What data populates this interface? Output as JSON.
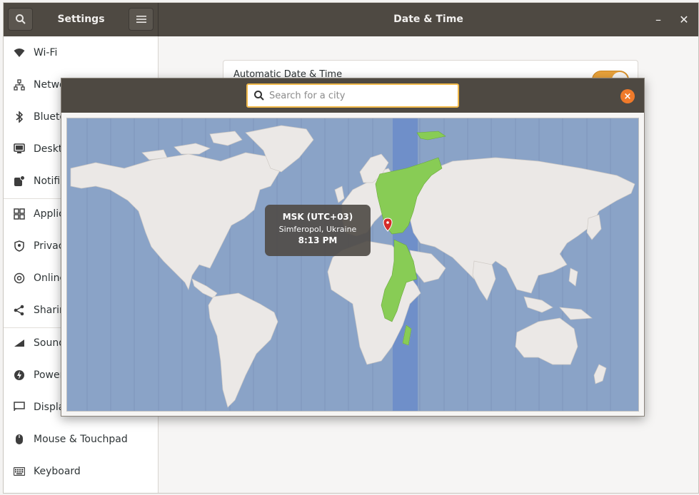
{
  "window": {
    "left_title": "Settings",
    "title": "Date & Time",
    "minimize_label": "–",
    "close_label": "✕"
  },
  "sidebar": {
    "items": [
      {
        "label": "Wi-Fi",
        "icon": "wifi-icon"
      },
      {
        "label": "Network",
        "icon": "network-icon"
      },
      {
        "label": "Bluetooth",
        "icon": "bluetooth-icon"
      },
      {
        "label": "Desktop",
        "icon": "desktop-icon"
      },
      {
        "label": "Notifications",
        "icon": "notifications-icon"
      },
      {
        "label": "Applications",
        "icon": "applications-icon"
      },
      {
        "label": "Privacy",
        "icon": "privacy-icon"
      },
      {
        "label": "Online Accounts",
        "icon": "online-accounts-icon"
      },
      {
        "label": "Sharing",
        "icon": "sharing-icon"
      },
      {
        "label": "Sound",
        "icon": "sound-icon"
      },
      {
        "label": "Power",
        "icon": "power-icon"
      },
      {
        "label": "Displays",
        "icon": "displays-icon"
      },
      {
        "label": "Mouse & Touchpad",
        "icon": "mouse-icon"
      },
      {
        "label": "Keyboard",
        "icon": "keyboard-icon"
      }
    ]
  },
  "content": {
    "auto_datetime_label": "Automatic Date & Time",
    "auto_datetime_enabled": true
  },
  "dialog": {
    "search_placeholder": "Search for a city",
    "search_value": "",
    "tooltip": {
      "zone": "MSK (UTC+03)",
      "city": "Simferopol, Ukraine",
      "time": "8:13 PM"
    }
  },
  "colors": {
    "headerbar": "#4e4942",
    "accent": "#f0b849",
    "toggle_on": "#e9a23b",
    "close_button": "#f07a2a",
    "ocean": "#8aa3c7",
    "highlight_band": "#6f8fc9",
    "land": "#ebe8e6",
    "selected_zone": "#88cc55",
    "pin": "#d42a2a"
  }
}
